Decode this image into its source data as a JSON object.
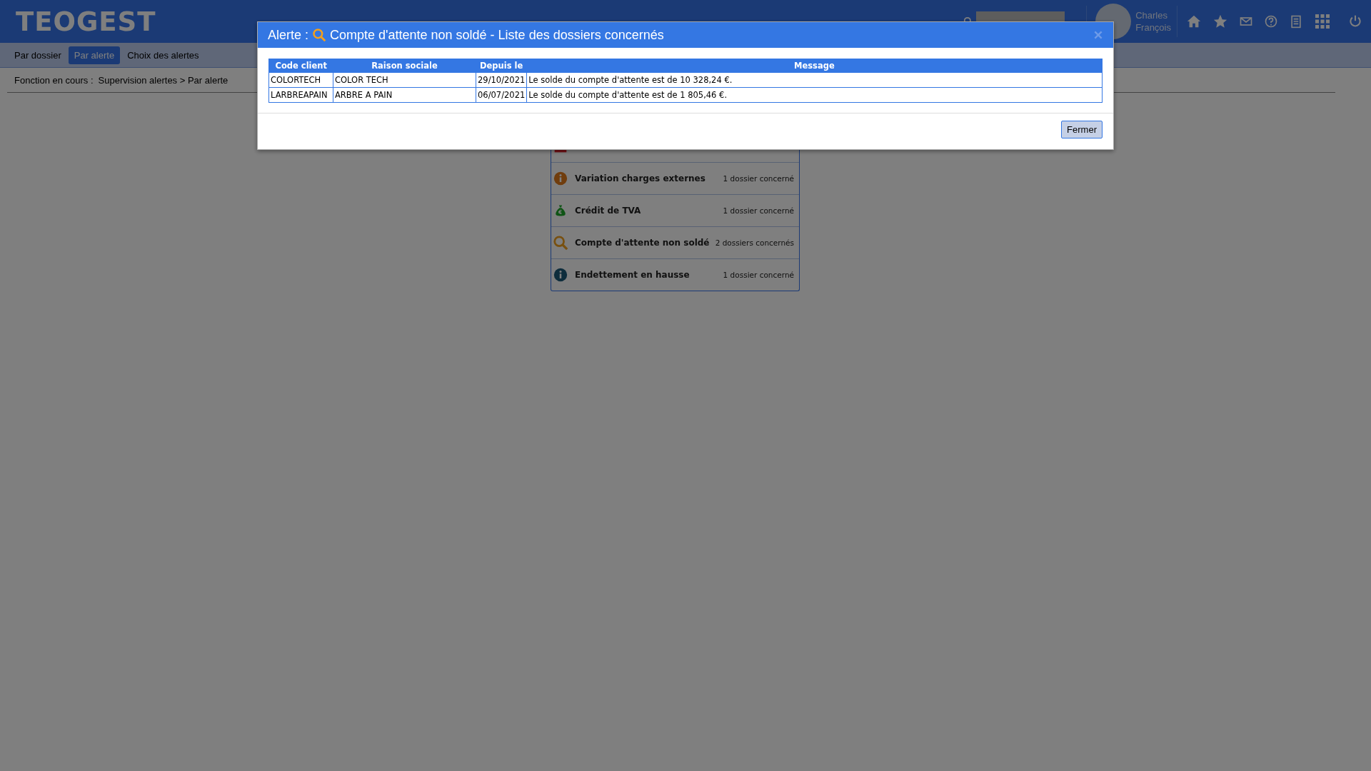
{
  "header": {
    "logo": "TEOGEST",
    "user": {
      "first_name": "Charles",
      "last_name": "François"
    }
  },
  "nav_tabs": [
    {
      "label": "Par dossier",
      "selected": false
    },
    {
      "label": "Par alerte",
      "selected": true
    },
    {
      "label": "Choix des alertes",
      "selected": false
    }
  ],
  "breadcrumb": {
    "label": "Fonction en cours :",
    "path": "Supervision alertes > Par alerte"
  },
  "alerts": [
    {
      "kind": "flag"
    },
    {
      "kind": "warning",
      "label": "Variation charges externes",
      "count": "1 dossier concerné"
    },
    {
      "kind": "money",
      "label": "Crédit de TVA",
      "count": "1 dossier concerné"
    },
    {
      "kind": "search",
      "label": "Compte d'attente non soldé",
      "count": "2 dossiers concernés"
    },
    {
      "kind": "info",
      "label": "Endettement en hausse",
      "count": "1 dossier concerné"
    }
  ],
  "modal": {
    "title_prefix": "Alerte :",
    "title": "Compte d'attente non soldé - Liste des dossiers concernés",
    "table": {
      "columns": [
        "Code client",
        "Raison sociale",
        "Depuis le",
        "Message"
      ],
      "rows": [
        [
          "COLORTECH",
          "COLOR TECH",
          "29/10/2021",
          "Le solde du compte d'attente est de 10 328,24 €."
        ],
        [
          "LARBREAPAIN",
          "ARBRE A PAIN",
          "06/07/2021",
          "Le solde du compte d'attente est de 1 805,46 €."
        ]
      ]
    },
    "button": "Fermer"
  }
}
